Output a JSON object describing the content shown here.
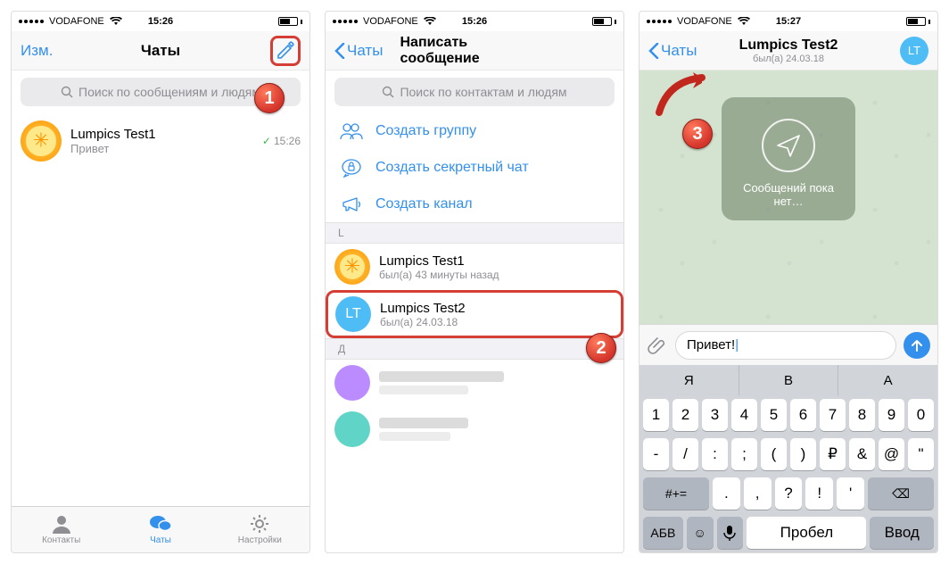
{
  "badges": {
    "b1": "1",
    "b2": "2",
    "b3": "3"
  },
  "screen1": {
    "status": {
      "carrier": "VODAFONE",
      "time": "15:26"
    },
    "nav": {
      "edit": "Изм.",
      "title": "Чаты"
    },
    "search_placeholder": "Поиск по сообщениям и людям",
    "chat": {
      "name": "Lumpics Test1",
      "preview": "Привет",
      "time": "15:26"
    },
    "tabs": {
      "contacts": "Контакты",
      "chats": "Чаты",
      "settings": "Настройки"
    }
  },
  "screen2": {
    "status": {
      "carrier": "VODAFONE",
      "time": "15:26"
    },
    "nav": {
      "back": "Чаты",
      "title": "Написать сообщение"
    },
    "search_placeholder": "Поиск по контактам и людям",
    "actions": {
      "group": "Создать группу",
      "secret": "Создать секретный чат",
      "channel": "Создать канал"
    },
    "section_l": "L",
    "contacts": {
      "c1": {
        "name": "Lumpics Test1",
        "status": "был(а) 43 минуты назад"
      },
      "c2": {
        "name": "Lumpics Test2",
        "status": "был(а) 24.03.18",
        "initials": "LT"
      }
    },
    "section_d": "Д"
  },
  "screen3": {
    "status": {
      "carrier": "VODAFONE",
      "time": "15:27"
    },
    "nav": {
      "back": "Чаты",
      "title": "Lumpics Test2",
      "subtitle": "был(а) 24.03.18",
      "initials": "LT"
    },
    "empty": "Сообщений пока нет…",
    "input_text": "Привет!",
    "kb_suggest": {
      "s1": "Я",
      "s2": "В",
      "s3": "А"
    },
    "kb": {
      "numrow": [
        "1",
        "2",
        "3",
        "4",
        "5",
        "6",
        "7",
        "8",
        "9",
        "0"
      ],
      "row2": [
        "-",
        "/",
        ":",
        ";",
        "(",
        ")",
        "₽",
        "&",
        "@",
        "\""
      ],
      "row3_shift": "#+=",
      "row3": [
        ".",
        ",",
        "?",
        "!",
        "'"
      ],
      "row3_del": "⌫",
      "abc": "АБВ",
      "space": "Пробел",
      "return": "Ввод"
    }
  }
}
